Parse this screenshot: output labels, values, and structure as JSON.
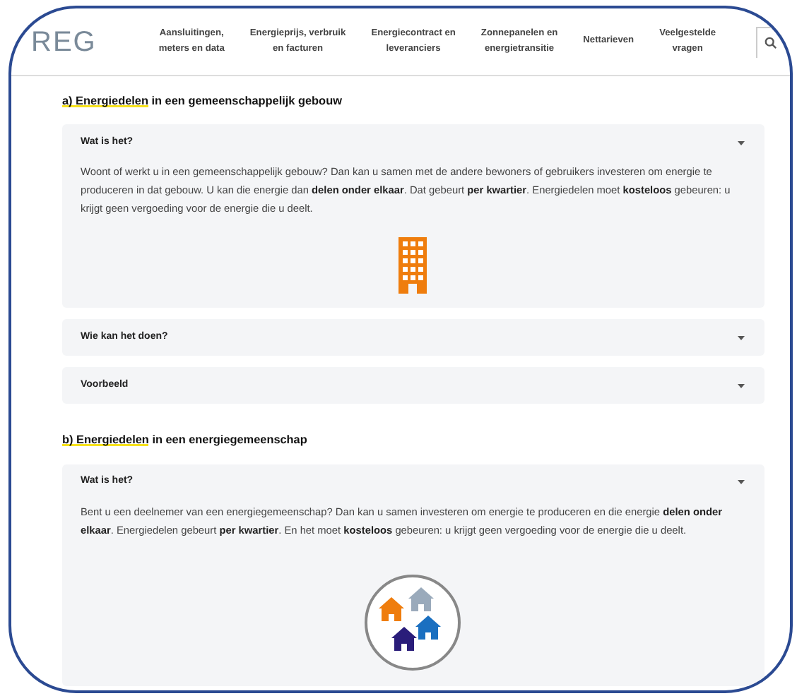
{
  "logo": {
    "text": "REG"
  },
  "nav": [
    {
      "lines": [
        "Aansluitingen,",
        "meters en data"
      ]
    },
    {
      "lines": [
        "Energieprijs, verbruik",
        "en facturen"
      ]
    },
    {
      "lines": [
        "Energiecontract en",
        "leveranciers"
      ]
    },
    {
      "lines": [
        "Zonnepanelen en",
        "energietransitie"
      ]
    },
    {
      "lines": [
        "Nettarieven"
      ]
    },
    {
      "lines": [
        "Veelgestelde",
        "vragen"
      ]
    }
  ],
  "sections": [
    {
      "marked": "a) Energiedelen",
      "rest": " in een gemeenschappelijk gebouw",
      "items": [
        {
          "title": "Wat is het?",
          "expanded": true,
          "body": "Woont of werkt u in een gemeenschappelijk gebouw? Dan kan u samen met de andere bewoners of gebruikers investeren om energie te produceren in dat gebouw. U kan die energie dan **delen onder elkaar**. Dat gebeurt **per kwartier**. Energiedelen moet **kosteloos** gebeuren: u krijgt geen vergoeding voor de energie die u deelt.",
          "kind": "building"
        },
        {
          "title": "Wie kan het doen?",
          "expanded": false
        },
        {
          "title": "Voorbeeld",
          "expanded": false
        }
      ]
    },
    {
      "marked": "b) Energiedelen",
      "rest": " in een energiegemeenschap",
      "items": [
        {
          "title": "Wat is het?",
          "expanded": true,
          "body": "Bent u een deelnemer van een energiegemeenschap? Dan kan u samen investeren om energie te produceren en die energie **delen onder elkaar**. Energiedelen gebeurt **per kwartier**. En het moet **kosteloos** gebeuren: u krijgt geen vergoeding voor de energie die u deelt.",
          "kind": "houses"
        }
      ]
    }
  ]
}
